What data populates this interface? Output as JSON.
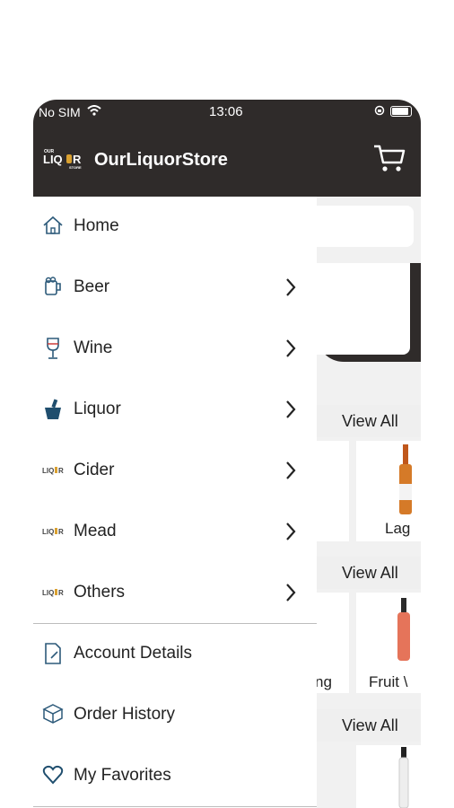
{
  "status": {
    "carrier": "No SIM",
    "time": "13:06"
  },
  "appbar": {
    "logo_text": "OUR LIQUOR STORE",
    "title": "OurLiquorStore"
  },
  "menu": {
    "items": [
      {
        "label": "Home",
        "icon": "home-icon",
        "has_chevron": false
      },
      {
        "label": "Beer",
        "icon": "beer-icon",
        "has_chevron": true
      },
      {
        "label": "Wine",
        "icon": "wine-glass-icon",
        "has_chevron": true
      },
      {
        "label": "Liquor",
        "icon": "liquor-bucket-icon",
        "has_chevron": true
      },
      {
        "label": "Cider",
        "icon": "store-logo-icon",
        "has_chevron": true
      },
      {
        "label": "Mead",
        "icon": "store-logo-icon",
        "has_chevron": true
      },
      {
        "label": "Others",
        "icon": "store-logo-icon",
        "has_chevron": true
      }
    ],
    "account_items": [
      {
        "label": "Account Details",
        "icon": "document-icon"
      },
      {
        "label": "Order History",
        "icon": "box-icon"
      },
      {
        "label": "My Favorites",
        "icon": "heart-icon"
      }
    ]
  },
  "background": {
    "view_all": [
      "View All",
      "View All",
      "View All"
    ],
    "peek_labels": [
      "Lag",
      "ng",
      "Fruit \\"
    ]
  }
}
